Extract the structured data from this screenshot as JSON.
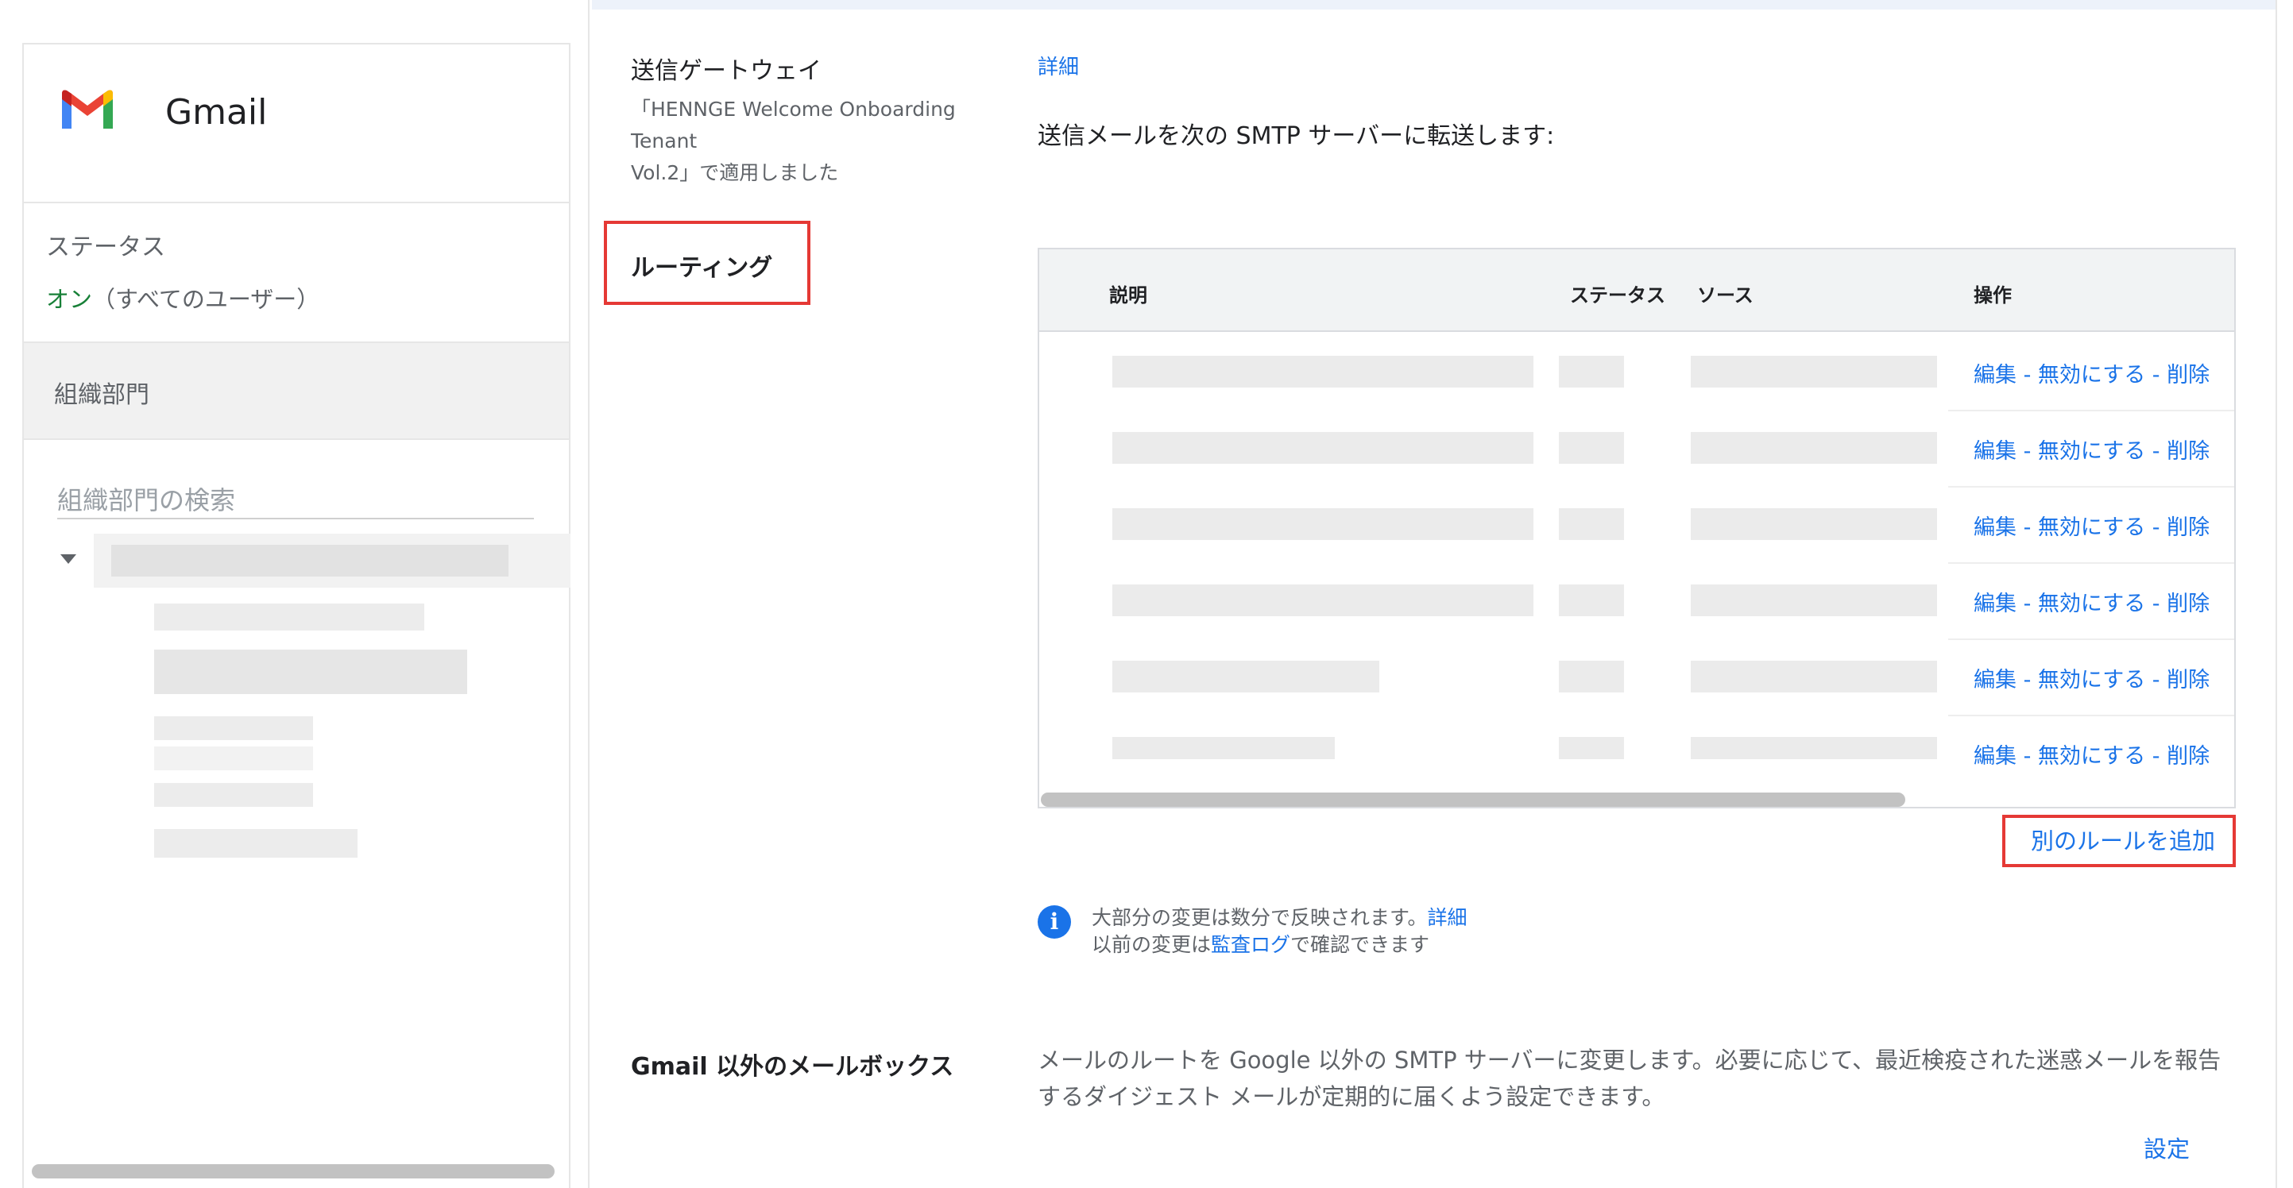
{
  "sidebar": {
    "app_title": "Gmail",
    "status_heading": "ステータス",
    "status_on": "オン",
    "status_scope": "（すべてのユーザー）",
    "org_title": "組織部門",
    "org_search_placeholder": "組織部門の検索"
  },
  "gateway": {
    "label": "送信ゲートウェイ",
    "applied_line1": "「HENNGE Welcome Onboarding Tenant",
    "applied_line2": "Vol.2」で適用しました",
    "detail_link": "詳細",
    "description": "送信メールを次の SMTP サーバーに転送します:"
  },
  "routing": {
    "label": "ルーティング",
    "table": {
      "columns": [
        "説明",
        "ステータス",
        "ソース",
        "操作"
      ],
      "rows": [
        {
          "edit": "編集",
          "disable": "無効にする",
          "delete": "削除"
        },
        {
          "edit": "編集",
          "disable": "無効にする",
          "delete": "削除"
        },
        {
          "edit": "編集",
          "disable": "無効にする",
          "delete": "削除"
        },
        {
          "edit": "編集",
          "disable": "無効にする",
          "delete": "削除"
        },
        {
          "edit": "編集",
          "disable": "無効にする",
          "delete": "削除"
        },
        {
          "edit": "編集",
          "disable": "無効にする",
          "delete": "削除"
        }
      ],
      "separator": " - "
    },
    "add_rule": "別のルールを追加",
    "info": {
      "icon": "info-icon",
      "line1_text": "大部分の変更は数分で反映されます。",
      "line1_link": "詳細",
      "line2_prefix": "以前の変更は",
      "line2_link": "監査ログ",
      "line2_suffix": "で確認できます"
    }
  },
  "non_gmail": {
    "label": "Gmail 以外のメールボックス",
    "description": "メールのルートを Google 以外の SMTP サーバーに変更します。必要に応じて、最近検疫された迷惑メールを報告するダイジェスト メールが定期的に届くよう設定できます。",
    "settings_link": "設定"
  },
  "colors": {
    "link": "#1a73e8",
    "status_on": "#188038",
    "highlight": "#e53935"
  }
}
